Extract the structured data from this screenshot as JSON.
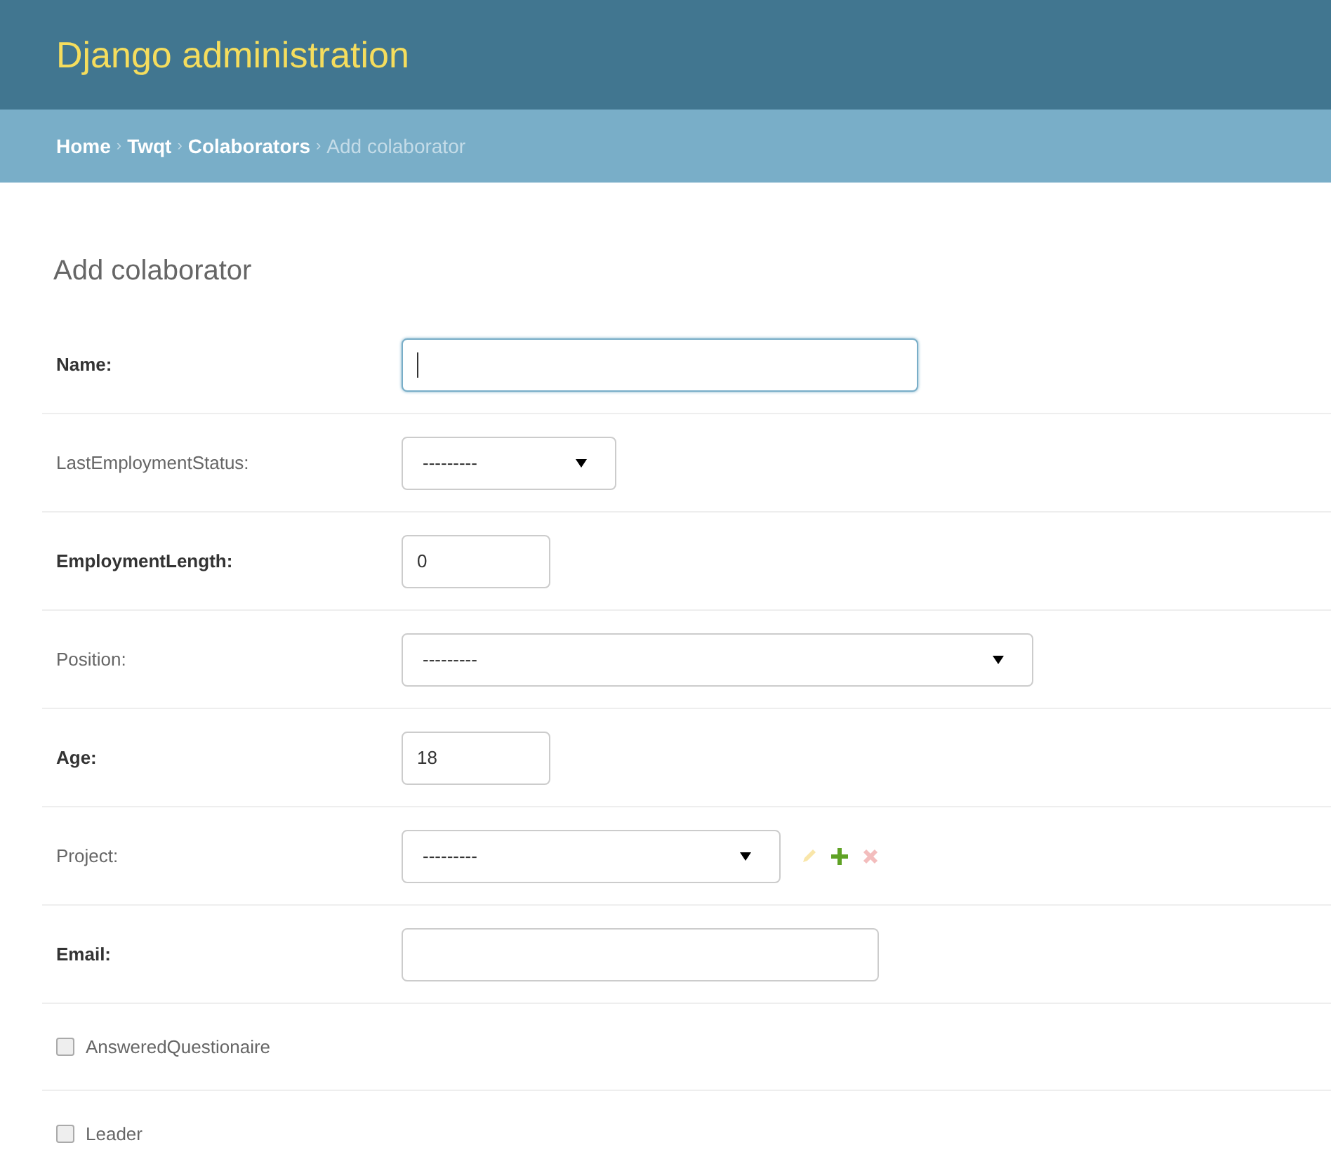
{
  "header": {
    "title": "Django administration"
  },
  "breadcrumbs": [
    {
      "kind": "link",
      "label": "Home"
    },
    {
      "kind": "separator",
      "label": "›"
    },
    {
      "kind": "link",
      "label": "Twqt"
    },
    {
      "kind": "separator",
      "label": "›"
    },
    {
      "kind": "link",
      "label": "Colaborators"
    },
    {
      "kind": "separator",
      "label": "›"
    },
    {
      "kind": "current",
      "label": "Add colaborator"
    }
  ],
  "page_title": "Add colaborator",
  "fields": [
    {
      "kind": "text",
      "label": "Name:",
      "required": true,
      "focused": true
    },
    {
      "kind": "select",
      "label": "LastEmploymentStatus:",
      "required": false,
      "value": "---------"
    },
    {
      "kind": "number",
      "label": "EmploymentLength:",
      "required": true,
      "value": "0",
      "focused": false
    },
    {
      "kind": "select",
      "label": "Position:",
      "required": false,
      "value": "---------"
    },
    {
      "kind": "number",
      "label": "Age:",
      "required": true,
      "value": "18",
      "focused": false
    },
    {
      "kind": "select",
      "label": "Project:",
      "required": false,
      "value": "---------",
      "actions": [
        {
          "kind": "change",
          "disabled": true
        },
        {
          "kind": "add",
          "disabled": false
        },
        {
          "kind": "delete",
          "disabled": true
        }
      ]
    },
    {
      "kind": "text",
      "label": "Email:",
      "required": true,
      "focused": false
    },
    {
      "kind": "checkbox",
      "label": "AnsweredQuestionaire",
      "checked": false
    },
    {
      "kind": "checkbox",
      "label": "Leader",
      "checked": false
    }
  ]
}
